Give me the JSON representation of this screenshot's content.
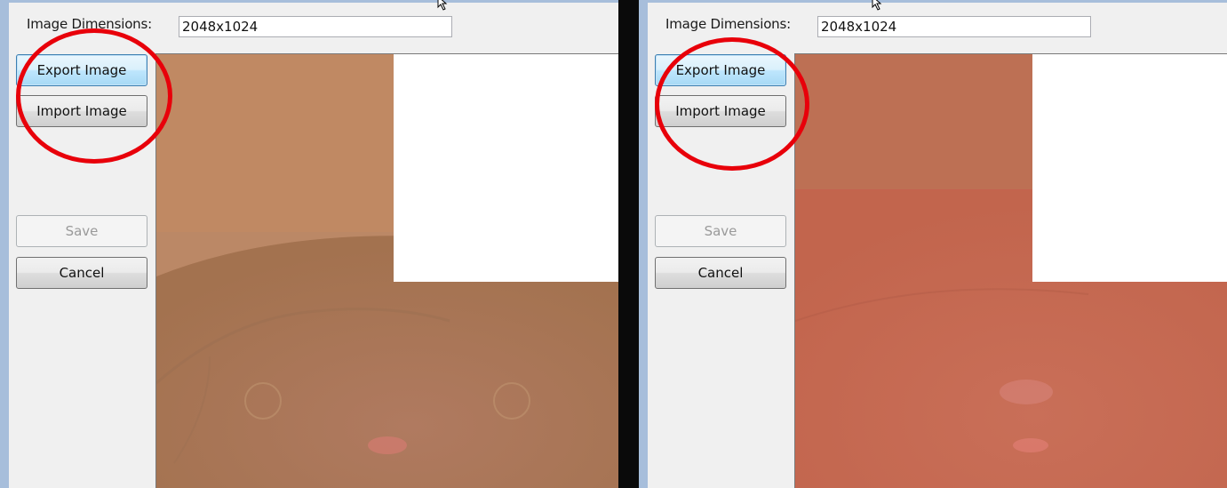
{
  "panels": [
    {
      "id": "left",
      "image_dimensions_label": "Image Dimensions:",
      "image_dimensions_value": "2048x1024",
      "buttons": {
        "export": "Export Image",
        "import": "Import Image",
        "save": "Save",
        "cancel": "Cancel"
      },
      "texture_color": "#b6845f"
    },
    {
      "id": "right",
      "image_dimensions_label": "Image Dimensions:",
      "image_dimensions_value": "2048x1024",
      "buttons": {
        "export": "Export Image",
        "import": "Import Image",
        "save": "Save",
        "cancel": "Cancel"
      },
      "texture_color": "#c0694f"
    }
  ],
  "colors": {
    "annotation": "#e8000a",
    "window_border": "#a7bedb",
    "separator": "#0a0a0a"
  },
  "icons": [
    "mouse-cursor-icon"
  ]
}
